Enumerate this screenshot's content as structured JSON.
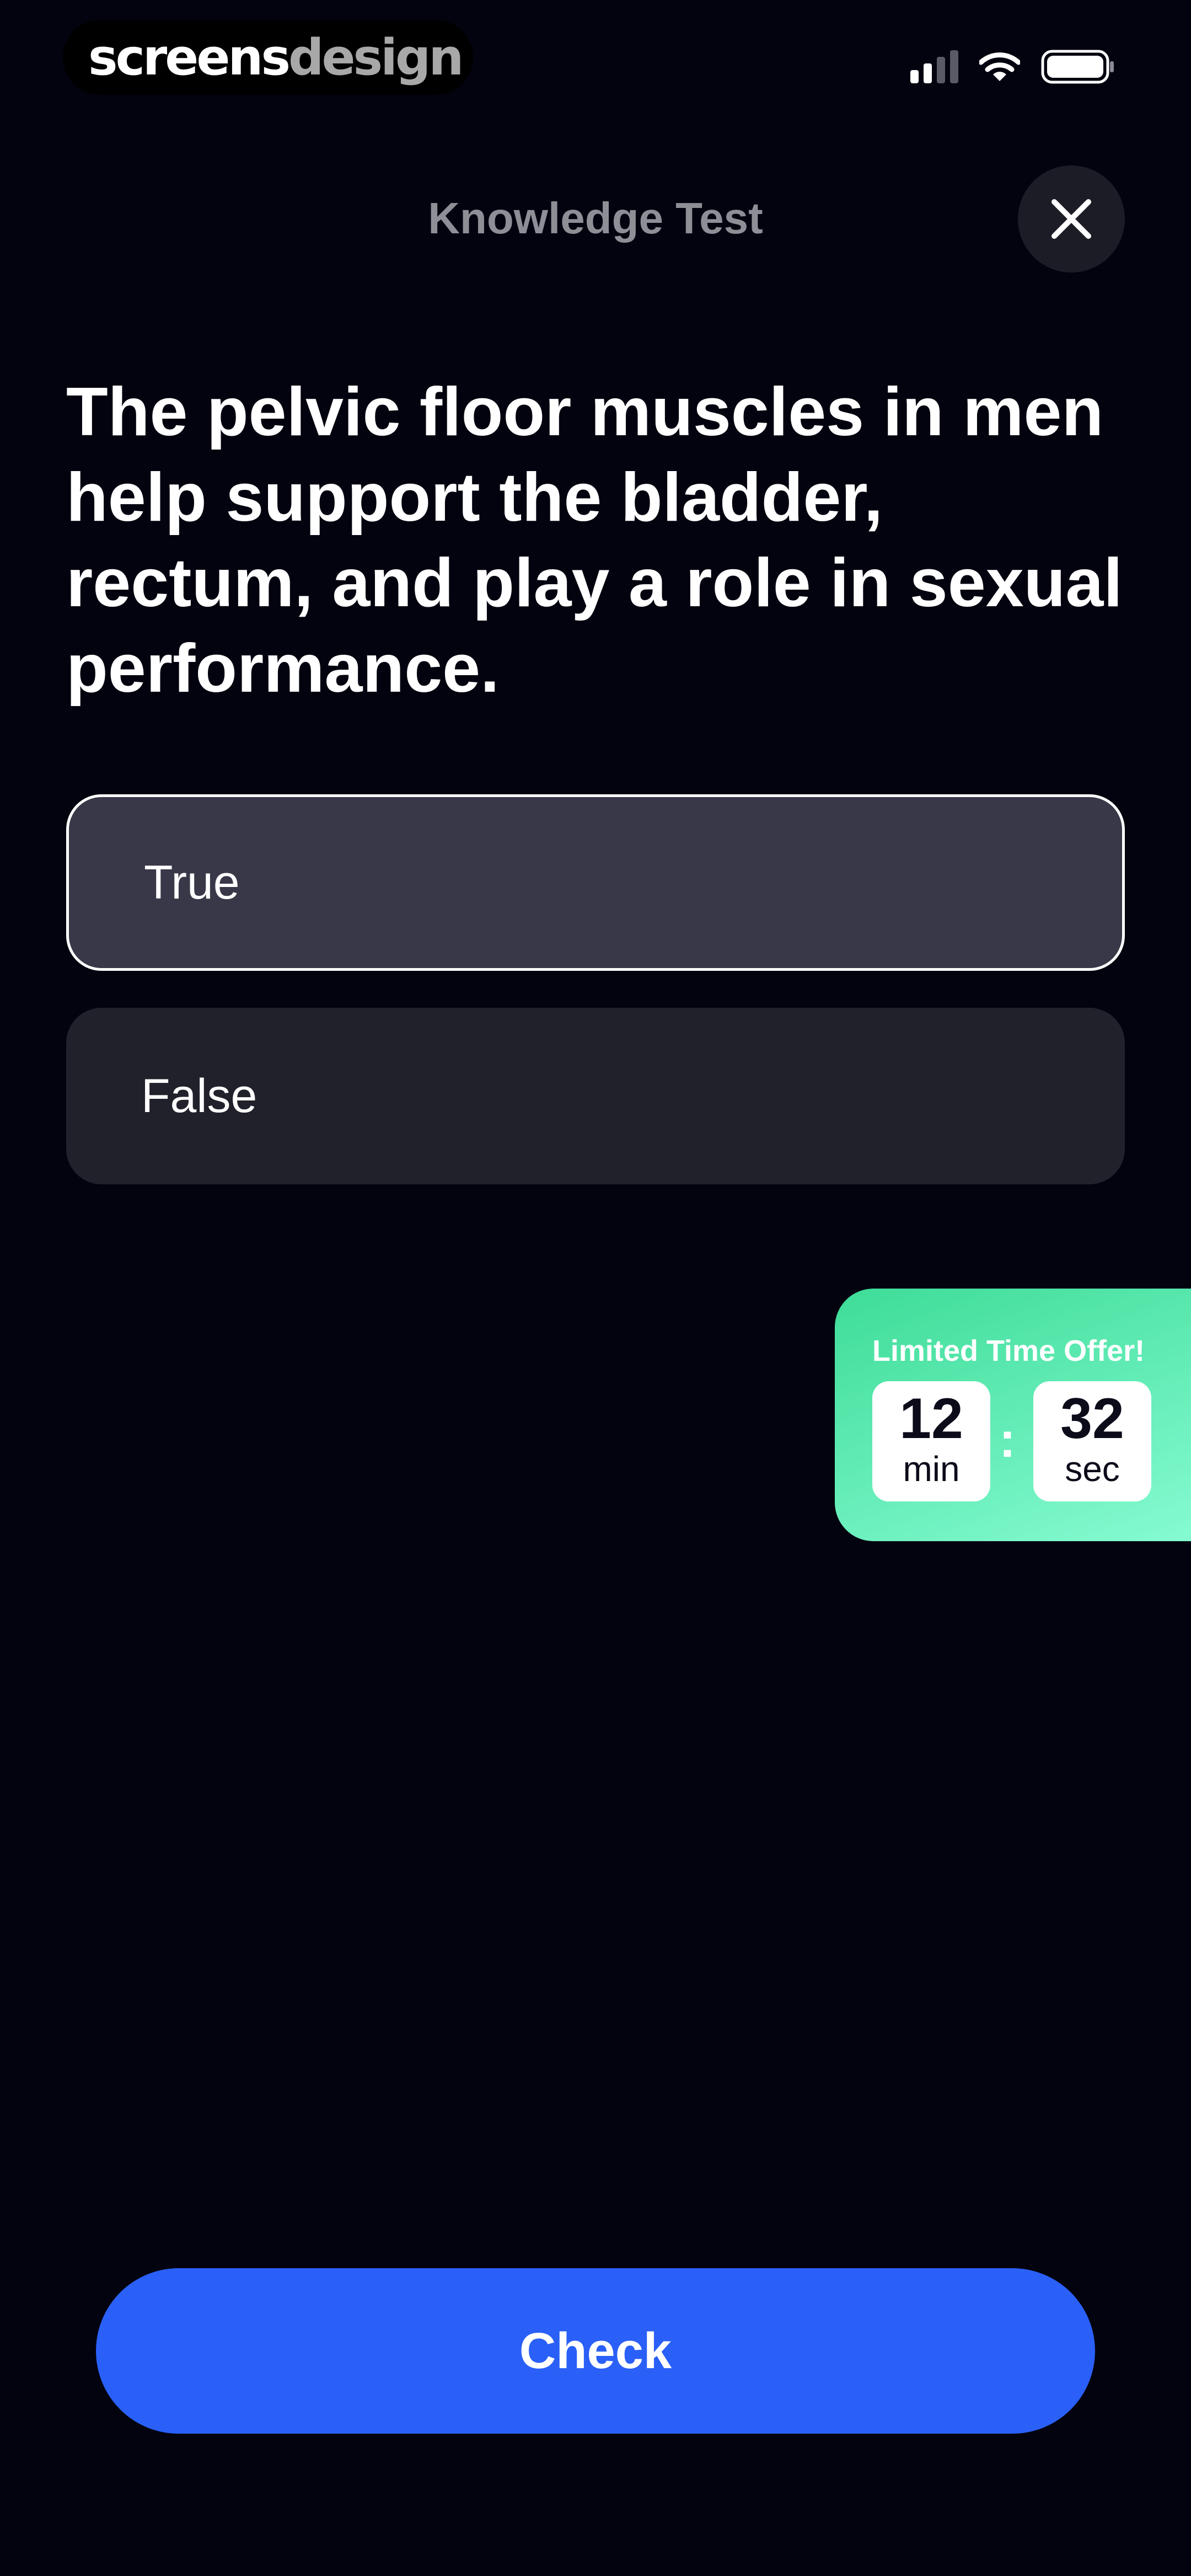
{
  "brand": {
    "part1": "screens",
    "part2": "design"
  },
  "header": {
    "title": "Knowledge Test"
  },
  "question": {
    "text": "The pelvic floor muscles in men help support the bladder, rectum, and play a role in sexual performance."
  },
  "options": [
    {
      "label": "True",
      "selected": true
    },
    {
      "label": "False",
      "selected": false
    }
  ],
  "offer": {
    "title": "Limited Time Offer!",
    "minutes": "12",
    "minutes_unit": "min",
    "separator": ":",
    "seconds": "32",
    "seconds_unit": "sec"
  },
  "check_button": {
    "label": "Check"
  },
  "colors": {
    "background": "#03030f",
    "primary": "#2a60f7",
    "selected_option": "#393848",
    "option": "#21212b",
    "offer_gradient_start": "#3edc98",
    "offer_gradient_end": "#86fbd2"
  },
  "icons": {
    "close": "close-icon",
    "signal": "cellular-signal-icon",
    "wifi": "wifi-icon",
    "battery": "battery-icon"
  }
}
